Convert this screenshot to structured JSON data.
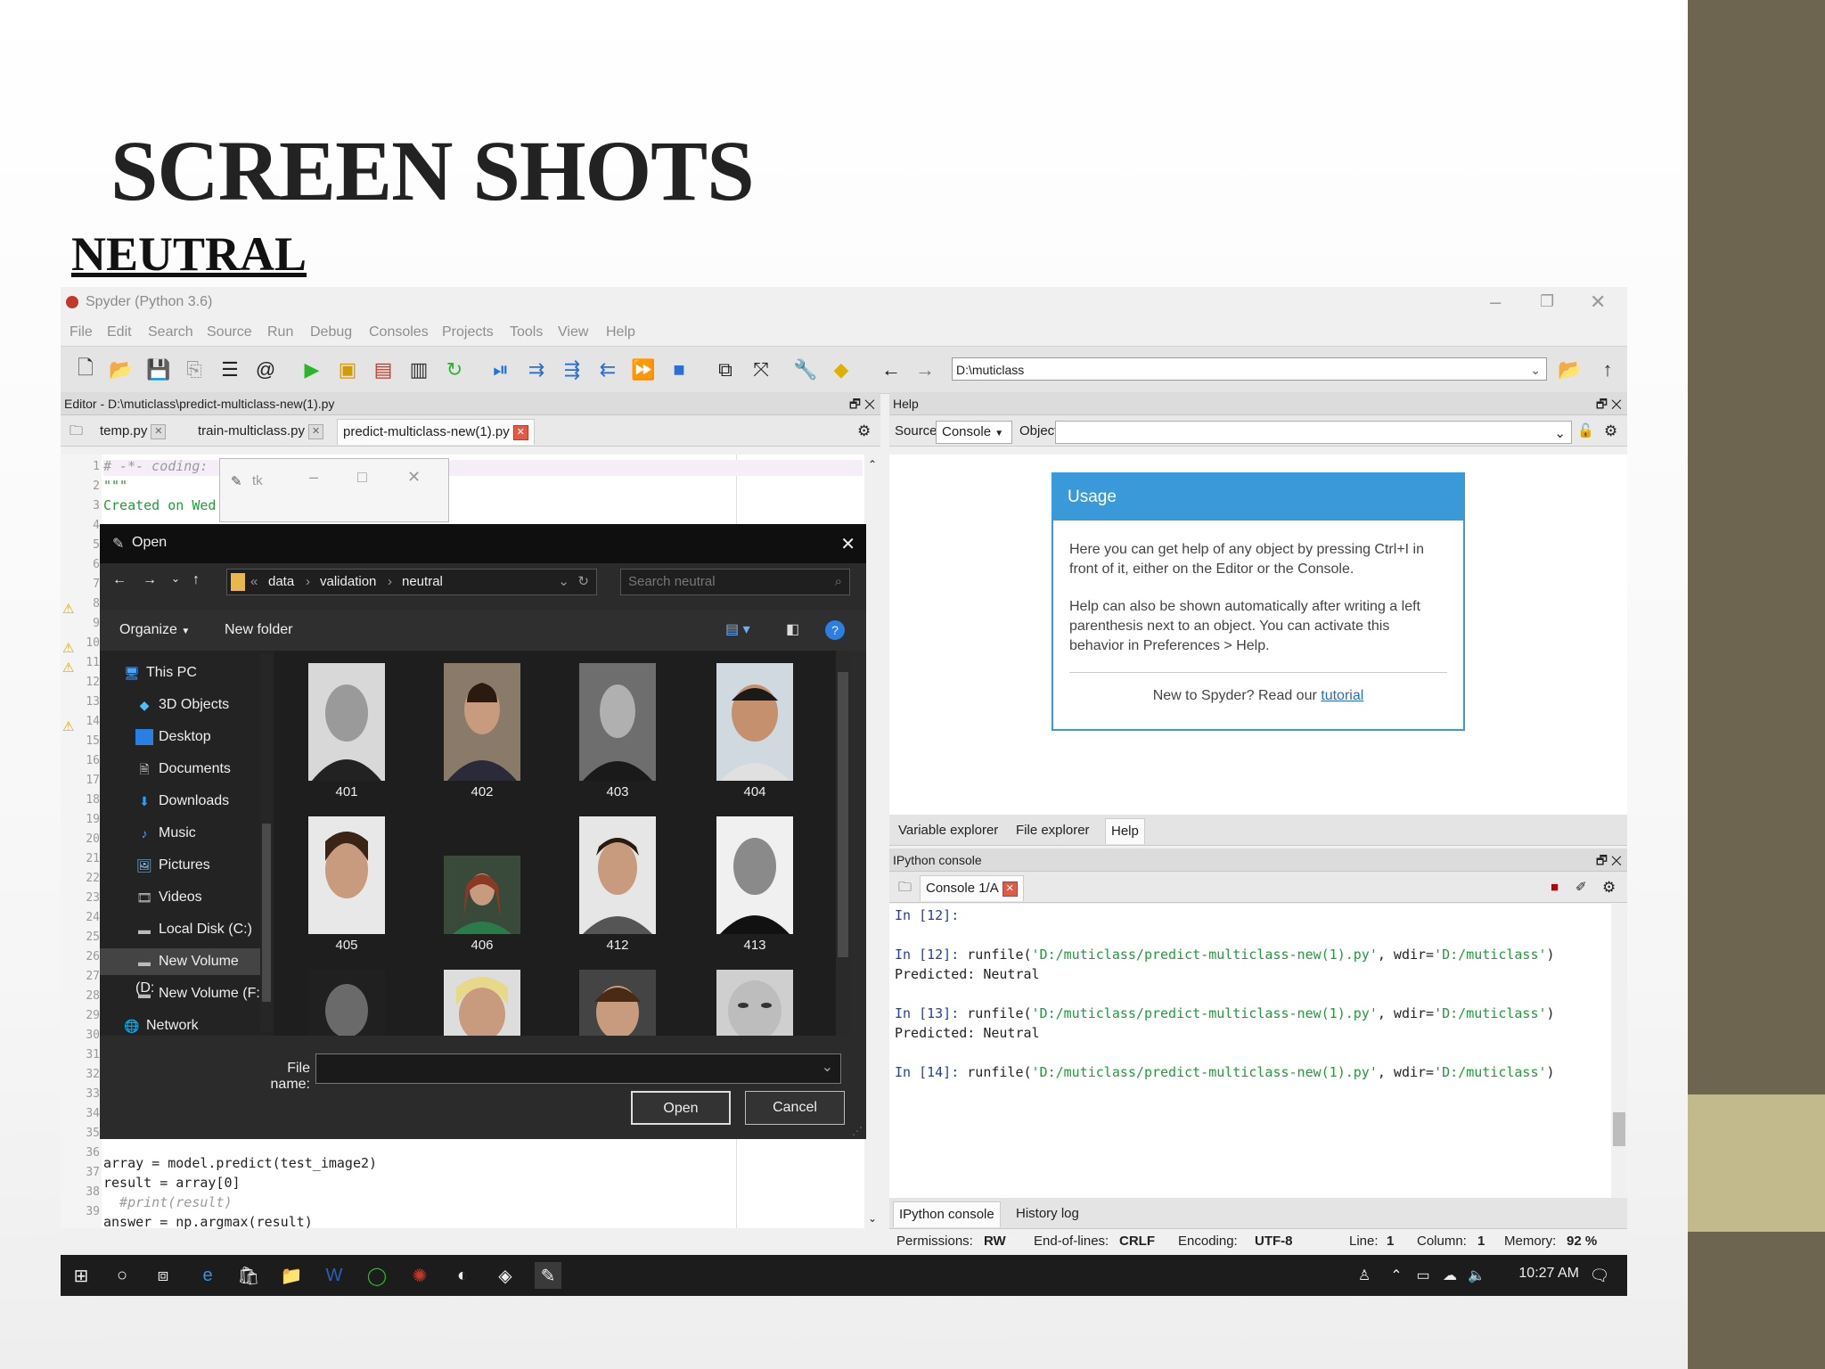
{
  "slide": {
    "title": "SCREEN SHOTS",
    "subtitle": "NEUTRAL"
  },
  "window": {
    "title": "Spyder (Python 3.6)"
  },
  "menu": [
    "File",
    "Edit",
    "Search",
    "Source",
    "Run",
    "Debug",
    "Consoles",
    "Projects",
    "Tools",
    "View",
    "Help"
  ],
  "toolbar": {
    "path": "D:\\muticlass"
  },
  "editor": {
    "header": "Editor - D:\\muticlass\\predict-multiclass-new(1).py",
    "tabs": [
      {
        "label": "temp.py"
      },
      {
        "label": "train-multiclass.py"
      },
      {
        "label": "predict-multiclass-new(1).py"
      }
    ],
    "line_numbers": [
      "1",
      "2",
      "3",
      "4",
      "5",
      "6",
      "7",
      "8",
      "9",
      "10",
      "11",
      "12",
      "13",
      "14",
      "15",
      "16",
      "17",
      "18",
      "19",
      "20",
      "21",
      "22",
      "23",
      "24",
      "25",
      "26",
      "27",
      "28",
      "29",
      "30",
      "31",
      "32",
      "33",
      "34",
      "35",
      "36",
      "37",
      "38",
      "39"
    ],
    "lines": [
      {
        "n": "1",
        "text": "# -*- coding:"
      },
      {
        "n": "2",
        "text": "\"\"\""
      },
      {
        "n": "3",
        "text": "Created on Wed"
      },
      {
        "n": "36",
        "text": "array = model.predict(test_image2)"
      },
      {
        "n": "37",
        "text": "result = array[0]"
      },
      {
        "n": "38",
        "text": "  #print(result)"
      },
      {
        "n": "39",
        "text": "answer = np.argmax(result)"
      }
    ]
  },
  "tk_window": {
    "title": "tk"
  },
  "open_dialog": {
    "title": "Open",
    "breadcrumb": [
      "data",
      "validation",
      "neutral"
    ],
    "search_placeholder": "Search neutral",
    "organize": "Organize",
    "new_folder": "New folder",
    "nav": [
      "This PC",
      "3D Objects",
      "Desktop",
      "Documents",
      "Downloads",
      "Music",
      "Pictures",
      "Videos",
      "Local Disk (C:)",
      "New Volume (D:",
      "New Volume (F:)",
      "Network"
    ],
    "files": [
      "401",
      "402",
      "403",
      "404",
      "405",
      "406",
      "412",
      "413"
    ],
    "file_name_label": "File name:",
    "file_name_value": "",
    "open_label": "Open",
    "cancel_label": "Cancel"
  },
  "help": {
    "header": "Help",
    "source_label": "Source",
    "source_value": "Console",
    "object_label": "Object",
    "usage_title": "Usage",
    "usage_text_1": "Here you can get help of any object by pressing Ctrl+I in front of it, either on the Editor or the Console.",
    "usage_text_2": "Help can also be shown automatically after writing a left parenthesis next to an object. You can activate this behavior in Preferences > Help.",
    "usage_footer": "New to Spyder? Read our",
    "usage_link": "tutorial",
    "tabs": [
      "Variable explorer",
      "File explorer",
      "Help"
    ]
  },
  "console": {
    "header": "IPython console",
    "tab": "Console 1/A",
    "lines": [
      {
        "prompt": "In [12]:",
        "code": ""
      },
      {
        "prompt": "In [12]:",
        "code": " runfile(",
        "str1": "'D:/muticlass/predict-multiclass-new(1).py'",
        "mid": ", wdir=",
        "str2": "'D:/muticlass'",
        "end": ")"
      },
      {
        "prompt": "Predicted: Neutral",
        "code": ""
      },
      {
        "prompt": "In [13]:",
        "code": " runfile(",
        "str1": "'D:/muticlass/predict-multiclass-new(1).py'",
        "mid": ", wdir=",
        "str2": "'D:/muticlass'",
        "end": ")"
      },
      {
        "prompt": "Predicted: Neutral",
        "code": ""
      },
      {
        "prompt": "In [14]:",
        "code": " runfile(",
        "str1": "'D:/muticlass/predict-multiclass-new(1).py'",
        "mid": ", wdir=",
        "str2": "'D:/muticlass'",
        "end": ")"
      }
    ],
    "tabs": [
      "IPython console",
      "History log"
    ]
  },
  "status": {
    "permissions_label": "Permissions:",
    "permissions": "RW",
    "eol_label": "End-of-lines:",
    "eol": "CRLF",
    "encoding_label": "Encoding:",
    "encoding": "UTF-8",
    "line_label": "Line:",
    "line": "1",
    "column_label": "Column:",
    "column": "1",
    "memory_label": "Memory:",
    "memory": "92 %"
  },
  "taskbar": {
    "time": "10:27 AM"
  },
  "colors": {
    "accent": "#3a9ad9",
    "run_green": "#2bb52b",
    "sidebar": "#6e6550",
    "sidebar_accent": "#c2b98c"
  }
}
